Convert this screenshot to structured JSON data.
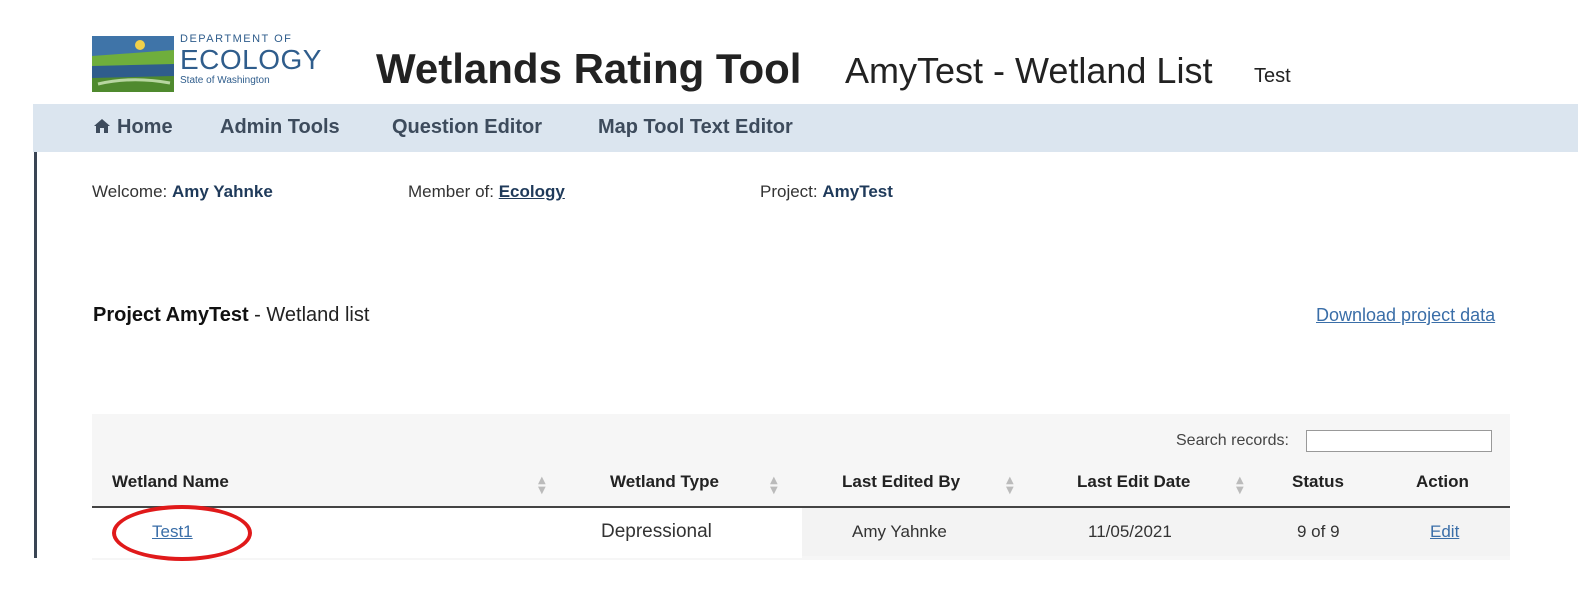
{
  "logo": {
    "dept": "DEPARTMENT OF",
    "name": "ECOLOGY",
    "state": "State of Washington"
  },
  "app_title": "Wetlands Rating Tool",
  "page_title": "AmyTest - Wetland List",
  "environment": "Test",
  "nav": {
    "home": "Home",
    "admin_tools": "Admin Tools",
    "question_editor": "Question Editor",
    "map_tool_text_editor": "Map Tool Text Editor"
  },
  "info": {
    "welcome_label": "Welcome:",
    "welcome_user": "Amy Yahnke",
    "member_label": "Member of:",
    "member_org": "Ecology",
    "project_label": "Project:",
    "project_name": "AmyTest"
  },
  "section": {
    "prefix": "Project AmyTest",
    "suffix": "- Wetland list",
    "download_link": "Download project data"
  },
  "table": {
    "search_label": "Search records:",
    "search_value": "",
    "columns": [
      "Wetland Name",
      "Wetland Type",
      "Last Edited By",
      "Last Edit Date",
      "Status",
      "Action"
    ],
    "rows": [
      {
        "name": "Test1",
        "type": "Depressional",
        "edited_by": "Amy Yahnke",
        "edit_date": "11/05/2021",
        "status": "9 of 9",
        "action": "Edit"
      }
    ]
  },
  "colors": {
    "nav_bg": "#dbe5ef",
    "link": "#3a6ea8",
    "highlight": "#e0191a"
  }
}
